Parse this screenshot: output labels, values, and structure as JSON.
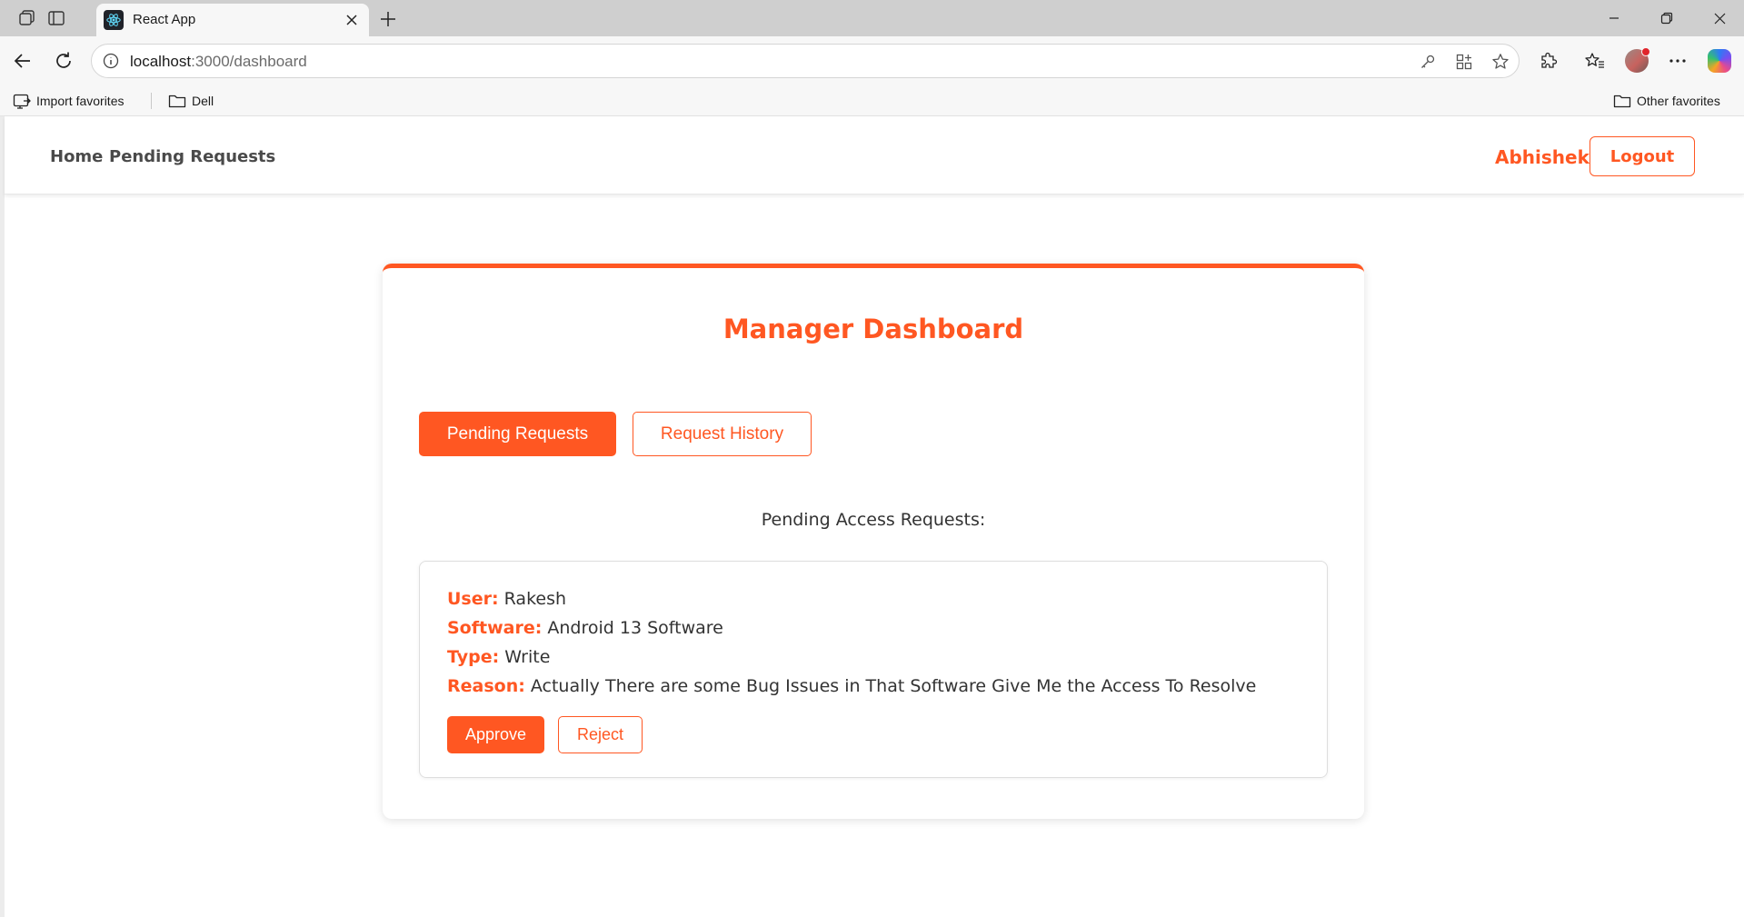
{
  "browser": {
    "tab_title": "React App",
    "url_host": "localhost",
    "url_path": ":3000/dashboard",
    "bookmarks": [
      "Import favorites",
      "Dell"
    ],
    "other_favorites": "Other favorites"
  },
  "navbar": {
    "links": [
      "Home",
      "Pending Requests"
    ],
    "user_name": "Abhishek",
    "logout_label": "Logout"
  },
  "dashboard": {
    "title": "Manager Dashboard",
    "tabs": [
      {
        "label": "Pending Requests",
        "active": true
      },
      {
        "label": "Request History",
        "active": false
      }
    ],
    "section_label": "Pending Access Requests:",
    "requests": [
      {
        "user_key": "User:",
        "user": "Rakesh",
        "software_key": "Software:",
        "software": "Android 13 Software",
        "type_key": "Type:",
        "type": "Write",
        "reason_key": "Reason:",
        "reason": "Actually There are some Bug Issues in That Software Give Me the Access To Resolve",
        "approve_label": "Approve",
        "reject_label": "Reject"
      }
    ]
  },
  "colors": {
    "accent": "#ff5722",
    "text": "#333333",
    "nav_text": "#4a4a4a"
  }
}
